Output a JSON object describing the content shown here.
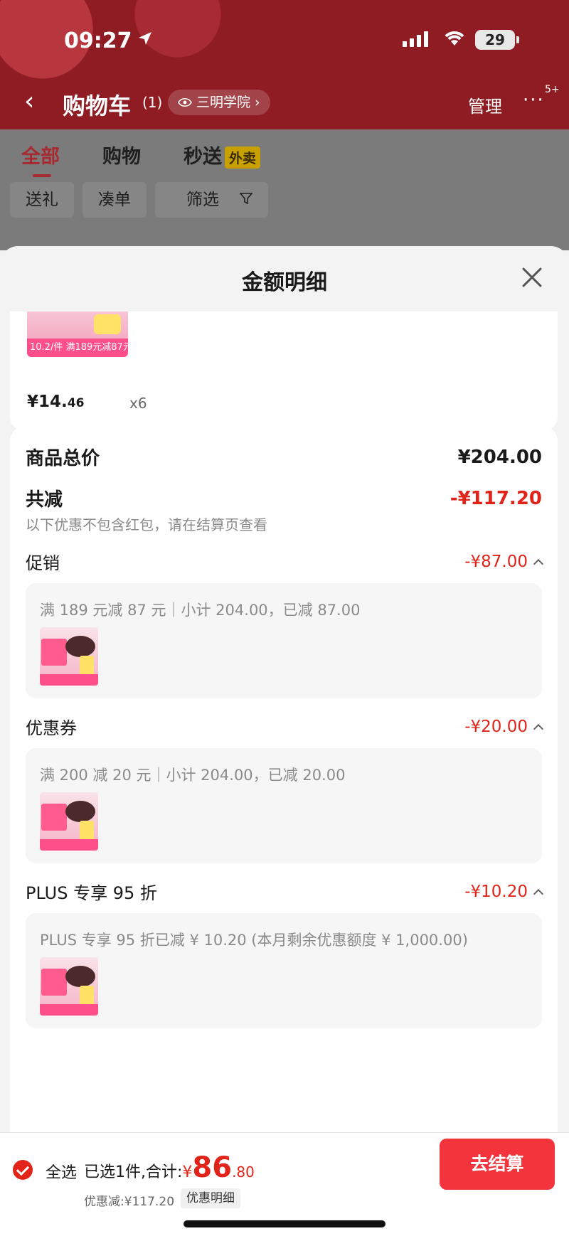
{
  "status_bar": {
    "time": "09:27",
    "battery": "29"
  },
  "nav": {
    "title": "购物车",
    "count": "(1)",
    "location": "三明学院",
    "manage": "管理",
    "more": "···",
    "badge": "5+"
  },
  "tabs": [
    {
      "label": "全部",
      "active": true
    },
    {
      "label": "购物"
    },
    {
      "label": "秒送",
      "tag": "外卖"
    }
  ],
  "filters": [
    "送礼",
    "凑单",
    "筛选"
  ],
  "sheet": {
    "title": "金额明细",
    "product": {
      "thumb_strip": "10.2/件 满189元减87元",
      "price_main": "¥14.",
      "price_decimal": "46",
      "quantity": "x6"
    },
    "summary": {
      "total_label": "商品总价",
      "total_value": "¥204.00",
      "discount_label": "共减",
      "discount_value": "-¥117.20",
      "note": "以下优惠不包含红包，请在结算页查看"
    },
    "sections": [
      {
        "label": "促销",
        "value": "-¥87.00",
        "detail": "满 189 元减 87 元｜小计 204.00，已减 87.00"
      },
      {
        "label": "优惠券",
        "value": "-¥20.00",
        "detail": "满 200 减 20 元｜小计 204.00，已减 20.00"
      },
      {
        "label": "PLUS 专享 95 折",
        "value": "-¥10.20",
        "detail": "PLUS 专享 95 折已减 ¥ 10.20 (本月剩余优惠额度 ¥ 1,000.00)"
      }
    ]
  },
  "bottom_bar": {
    "select_all": "全选",
    "selected_prefix": "已选1件,合计:",
    "total_symbol": "¥",
    "total_int": "86",
    "total_dec": ".80",
    "discount_text": "优惠减:¥117.20",
    "detail_link": "优惠明细",
    "checkout": "去结算"
  },
  "colors": {
    "accent_red": "#e2231a",
    "header_red": "#8e1c22",
    "checkout_red": "#f3343c"
  }
}
